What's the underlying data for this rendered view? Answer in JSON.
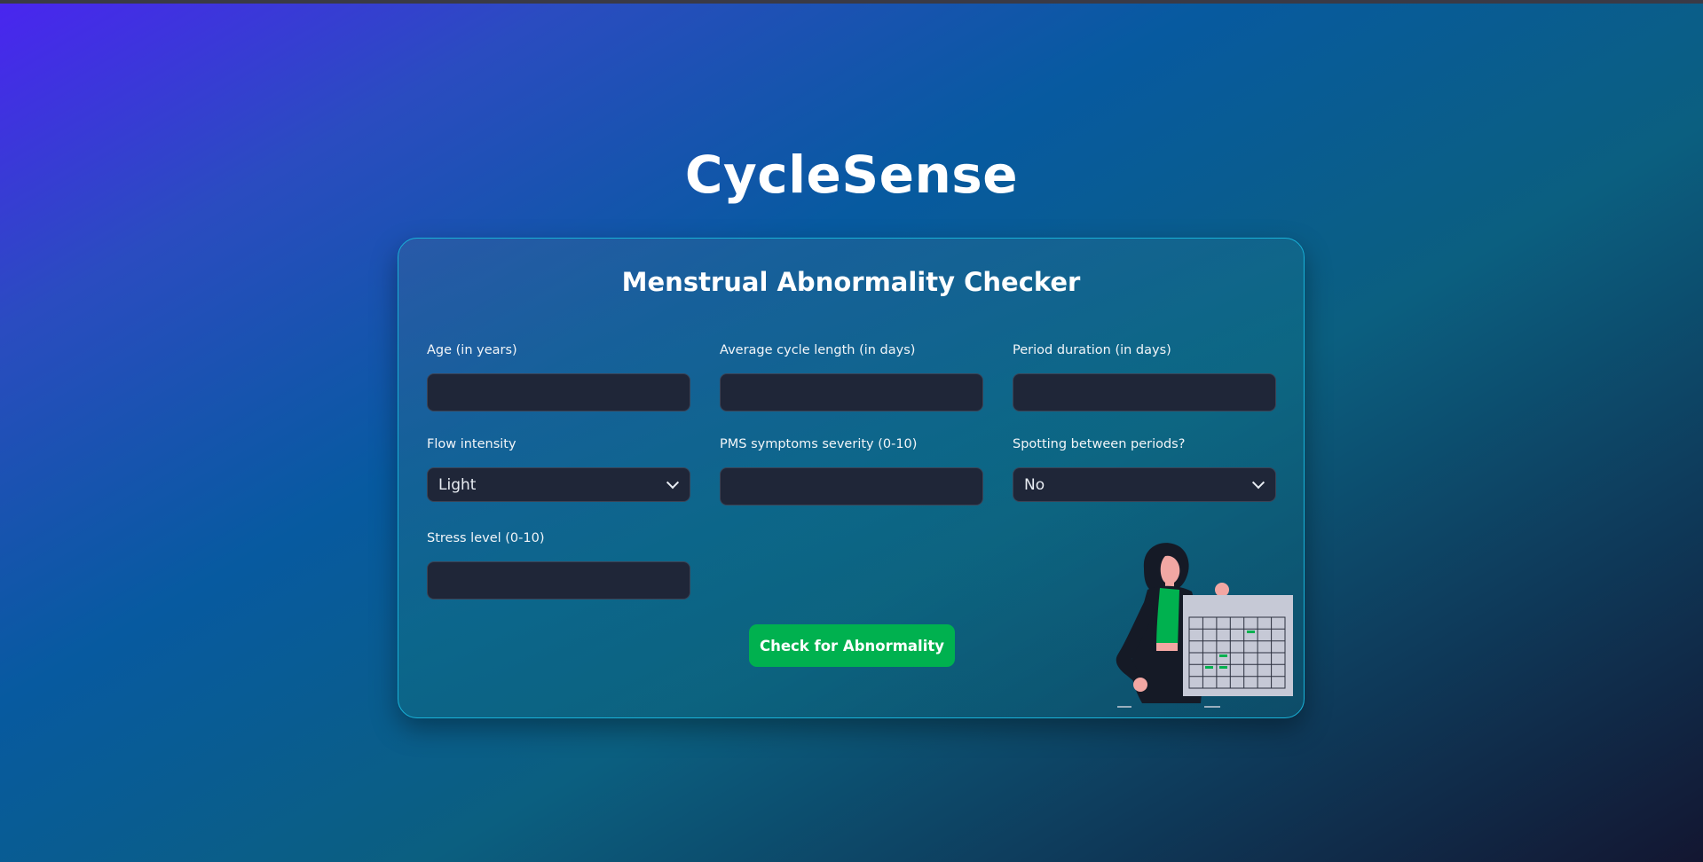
{
  "app": {
    "title": "CycleSense"
  },
  "form": {
    "title": "Menstrual Abnormality Checker",
    "fields": {
      "age": {
        "label": "Age (in years)",
        "value": ""
      },
      "cycle_length": {
        "label": "Average cycle length (in days)",
        "value": ""
      },
      "period_duration": {
        "label": "Period duration (in days)",
        "value": ""
      },
      "flow_intensity": {
        "label": "Flow intensity",
        "selected": "Light"
      },
      "pms_severity": {
        "label": "PMS symptoms severity (0-10)",
        "value": ""
      },
      "spotting": {
        "label": "Spotting between periods?",
        "selected": "No"
      },
      "stress_level": {
        "label": "Stress level (0-10)",
        "value": ""
      }
    },
    "submit_label": "Check for Abnormality"
  },
  "colors": {
    "accent": "#00b14f",
    "card_border": "#19b2d8",
    "input_bg": "#1f2638"
  },
  "icons": {
    "illustration": "woman-with-calendar-illustration",
    "select_arrow": "chevron-down-icon"
  }
}
